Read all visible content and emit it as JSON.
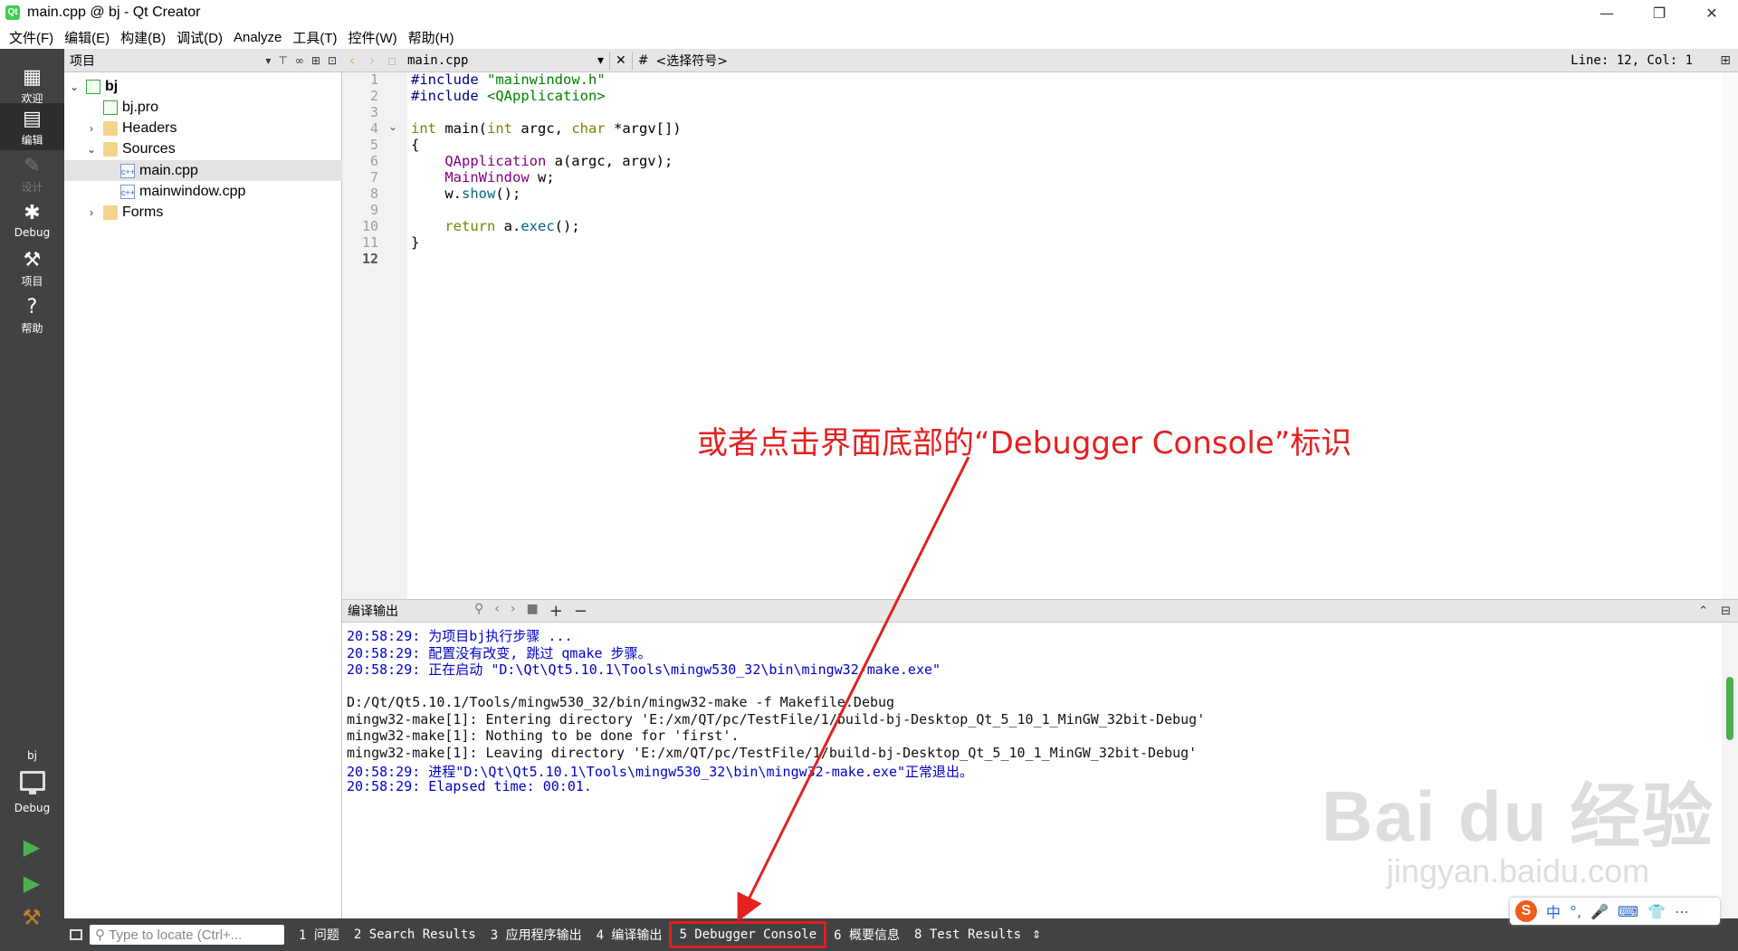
{
  "window": {
    "title": "main.cpp @ bj - Qt Creator",
    "app_icon": "Qt",
    "minimize": "—",
    "restore": "❐",
    "close": "✕"
  },
  "menu": [
    "文件(F)",
    "编辑(E)",
    "构建(B)",
    "调试(D)",
    "Analyze",
    "工具(T)",
    "控件(W)",
    "帮助(H)"
  ],
  "modes": [
    {
      "label": "欢迎",
      "icon": "grid-icon"
    },
    {
      "label": "编辑",
      "icon": "edit-icon"
    },
    {
      "label": "设计",
      "icon": "design-icon"
    },
    {
      "label": "Debug",
      "icon": "bug-icon"
    },
    {
      "label": "项目",
      "icon": "wrench-icon"
    },
    {
      "label": "帮助",
      "icon": "help-icon"
    }
  ],
  "kit": {
    "project": "bj",
    "mode": "Debug"
  },
  "project_pane": {
    "title": "项目",
    "tree": [
      {
        "label": "bj",
        "depth": 0,
        "arrow": "⌄",
        "icon": "pro"
      },
      {
        "label": "bj.pro",
        "depth": 1,
        "arrow": "",
        "icon": "pro"
      },
      {
        "label": "Headers",
        "depth": 1,
        "arrow": "›",
        "icon": "folder"
      },
      {
        "label": "Sources",
        "depth": 1,
        "arrow": "⌄",
        "icon": "folder"
      },
      {
        "label": "main.cpp",
        "depth": 2,
        "arrow": "",
        "icon": "file",
        "selected": true
      },
      {
        "label": "mainwindow.cpp",
        "depth": 2,
        "arrow": "",
        "icon": "file"
      },
      {
        "label": "Forms",
        "depth": 1,
        "arrow": "›",
        "icon": "folder"
      }
    ]
  },
  "editor": {
    "file_name": "main.cpp",
    "symbols": "<选择符号>",
    "hash": "#",
    "line_col": "Line: 12, Col: 1",
    "current_line": 12,
    "lines": [
      "#include \"mainwindow.h\"",
      "#include <QApplication>",
      "",
      "int main(int argc, char *argv[])",
      "{",
      "    QApplication a(argc, argv);",
      "    MainWindow w;",
      "    w.show();",
      "",
      "    return a.exec();",
      "}",
      ""
    ]
  },
  "output": {
    "title": "编译输出",
    "lines": [
      {
        "text": "20:58:29: 为项目bj执行步骤 ...",
        "color": "blue"
      },
      {
        "text": "20:58:29: 配置没有改变, 跳过 qmake 步骤。",
        "color": "blue"
      },
      {
        "text": "20:58:29: 正在启动 \"D:\\Qt\\Qt5.10.1\\Tools\\mingw530_32\\bin\\mingw32-make.exe\"",
        "color": "blue"
      },
      {
        "text": "",
        "color": "black"
      },
      {
        "text": "D:/Qt/Qt5.10.1/Tools/mingw530_32/bin/mingw32-make -f Makefile.Debug",
        "color": "black"
      },
      {
        "text": "mingw32-make[1]: Entering directory 'E:/xm/QT/pc/TestFile/1/build-bj-Desktop_Qt_5_10_1_MinGW_32bit-Debug'",
        "color": "black"
      },
      {
        "text": "mingw32-make[1]: Nothing to be done for 'first'.",
        "color": "black"
      },
      {
        "text": "mingw32-make[1]: Leaving directory 'E:/xm/QT/pc/TestFile/1/build-bj-Desktop_Qt_5_10_1_MinGW_32bit-Debug'",
        "color": "black"
      },
      {
        "text": "20:58:29: 进程\"D:\\Qt\\Qt5.10.1\\Tools\\mingw530_32\\bin\\mingw32-make.exe\"正常退出。",
        "color": "blue"
      },
      {
        "text": "20:58:29: Elapsed time: 00:01.",
        "color": "blue"
      }
    ]
  },
  "statusbar": {
    "locator_placeholder": "Type to locate (Ctrl+...",
    "tabs": [
      {
        "label": "1 问题"
      },
      {
        "label": "2 Search Results"
      },
      {
        "label": "3 应用程序输出"
      },
      {
        "label": "4 编译输出"
      },
      {
        "label": "5 Debugger Console",
        "highlight": true
      },
      {
        "label": "6 概要信息"
      },
      {
        "label": "8 Test Results"
      }
    ]
  },
  "annotation": {
    "text": "或者点击界面底部的“Debugger Console”标识",
    "color": "#e42020"
  },
  "watermark": {
    "main": "Bai du 经验",
    "sub": "jingyan.baidu.com"
  },
  "ime": {
    "logo": "S",
    "items": [
      "中",
      "°,",
      "🎤",
      "⌨",
      "👕",
      "⋯"
    ]
  },
  "colors": {
    "accent_red": "#e02020",
    "output_blue": "#0000c8",
    "sidebar": "#404244"
  }
}
